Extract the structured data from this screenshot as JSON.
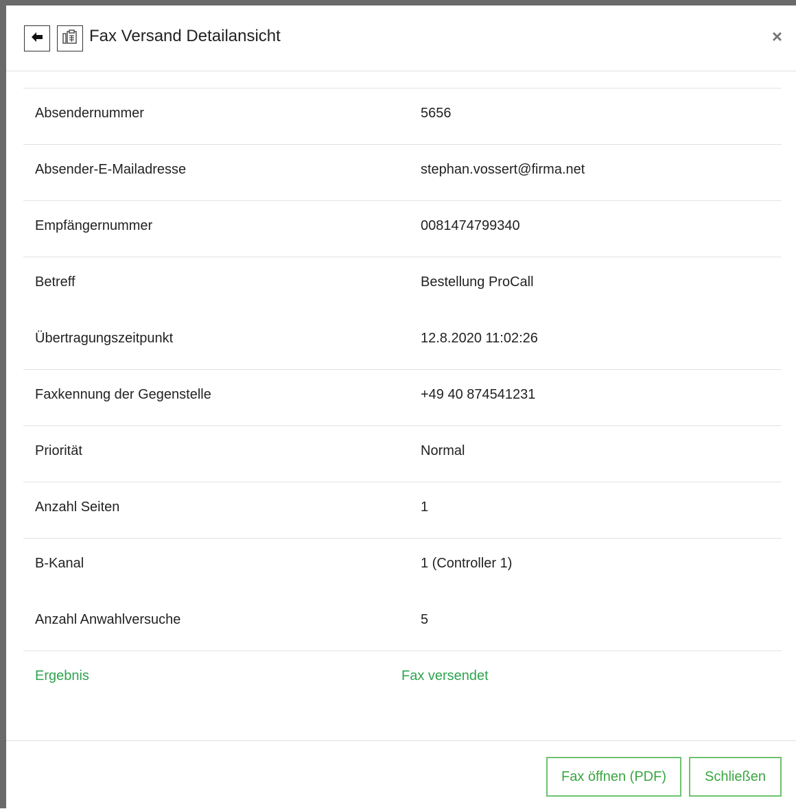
{
  "header": {
    "title": "Fax Versand Detailansicht",
    "close_glyph": "×",
    "back_icon": "arrow-left-icon",
    "copy_icon": "clipboard-icon"
  },
  "details": [
    {
      "label": "Absendernummer",
      "value": "5656"
    },
    {
      "label": "Absender-E-Mailadresse",
      "value": "stephan.vossert@firma.net"
    },
    {
      "label": "Empfängernummer",
      "value": "0081474799340"
    },
    {
      "label": "Betreff",
      "value": "Bestellung ProCall"
    },
    {
      "label": "Übertragungszeitpunkt",
      "value": "12.8.2020 11:02:26"
    },
    {
      "label": "Faxkennung der Gegenstelle",
      "value": "+49 40 874541231"
    },
    {
      "label": "Priorität",
      "value": "Normal"
    },
    {
      "label": "Anzahl Seiten",
      "value": "1"
    },
    {
      "label": "B-Kanal",
      "value": "1 (Controller 1)"
    },
    {
      "label": "Anzahl Anwahlversuche",
      "value": "5"
    }
  ],
  "result": {
    "label": "Ergebnis",
    "value": "Fax versendet",
    "color": "#2ea44f"
  },
  "footer": {
    "open_pdf_label": "Fax öffnen (PDF)",
    "close_label": "Schließen"
  }
}
